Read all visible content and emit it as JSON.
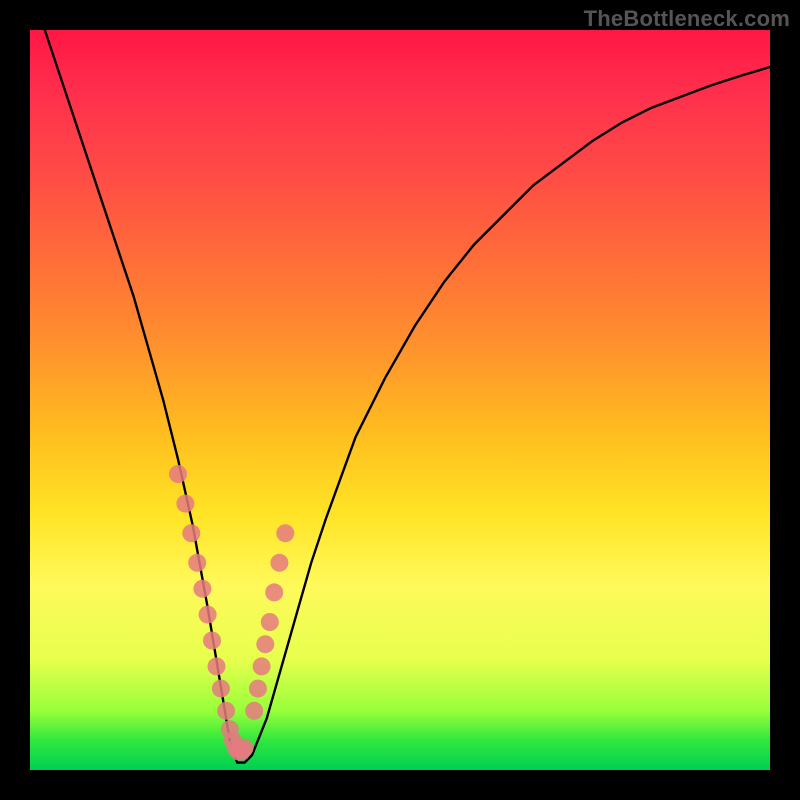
{
  "watermark": "TheBottleneck.com",
  "chart_data": {
    "type": "line",
    "title": "",
    "xlabel": "",
    "ylabel": "",
    "xlim": [
      0,
      100
    ],
    "ylim": [
      0,
      100
    ],
    "grid": false,
    "legend": false,
    "description": "Bottleneck curve — a V-shaped function that drops steeply from the top-left, reaches near-zero around x≈28, then rises smoothly to the upper-right. Background is a vertical rainbow gradient (red→green). A cluster of semi-transparent pink markers sits on both arms of the curve near the trough.",
    "series": [
      {
        "name": "bottleneck-curve",
        "x": [
          2,
          4,
          6,
          8,
          10,
          12,
          14,
          16,
          18,
          20,
          22,
          24,
          26,
          27,
          28,
          29,
          30,
          32,
          34,
          36,
          38,
          40,
          44,
          48,
          52,
          56,
          60,
          64,
          68,
          72,
          76,
          80,
          84,
          88,
          92,
          96,
          100
        ],
        "values": [
          100,
          94,
          88,
          82,
          76,
          70,
          64,
          57,
          50,
          42,
          33,
          22,
          10,
          4,
          1,
          1,
          2,
          7,
          14,
          21,
          28,
          34,
          45,
          53,
          60,
          66,
          71,
          75,
          79,
          82,
          85,
          87.5,
          89.5,
          91,
          92.5,
          93.8,
          95
        ]
      },
      {
        "name": "markers",
        "type": "scatter",
        "x": [
          20,
          21,
          21.8,
          22.6,
          23.3,
          24,
          24.6,
          25.2,
          25.8,
          26.5,
          27,
          27.4,
          27.8,
          28.2,
          28.6,
          29,
          30.3,
          30.8,
          31.3,
          31.8,
          32.4,
          33,
          33.7,
          34.5
        ],
        "values": [
          40,
          36,
          32,
          28,
          24.5,
          21,
          17.5,
          14,
          11,
          8,
          5.5,
          4,
          3,
          2.5,
          2.5,
          3,
          8,
          11,
          14,
          17,
          20,
          24,
          28,
          32
        ]
      }
    ]
  }
}
